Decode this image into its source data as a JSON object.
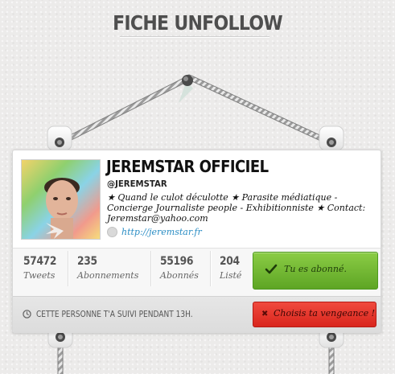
{
  "page": {
    "title": "FICHE UNFOLLOW"
  },
  "profile": {
    "name": "JEREMSTAR OFFICIEL",
    "handle": "@JEREMSTAR",
    "bio": "★ Quand le culot déculotte ★ Parasite médiatique - Concierge Journaliste people - Exhibitionniste ★ Contact: Jeremstar@yahoo.com",
    "url": "http://jeremstar.fr"
  },
  "stats": [
    {
      "value": "57472",
      "label": "Tweets"
    },
    {
      "value": "235",
      "label": "Abonnements"
    },
    {
      "value": "55196",
      "label": "Abonnés"
    },
    {
      "value": "204",
      "label": "Listé"
    }
  ],
  "follow_button": {
    "label": "Tu es abonné."
  },
  "info": {
    "text": "CETTE PERSONNE T'A SUIVI PENDANT 13H."
  },
  "revenge_button": {
    "label": "Choisis ta vengeance !"
  },
  "colors": {
    "green": "#6cb22e",
    "red": "#e3342a",
    "link": "#2a8dc4"
  }
}
